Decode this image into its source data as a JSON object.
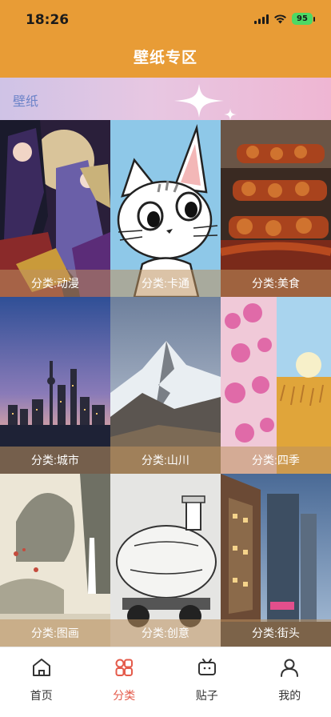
{
  "status_bar": {
    "time": "18:26",
    "battery": "95"
  },
  "header": {
    "title": "壁纸专区"
  },
  "banner": {
    "label": "壁纸"
  },
  "grid": {
    "tiles": [
      {
        "caption": "分类:动漫"
      },
      {
        "caption": "分类:卡通"
      },
      {
        "caption": "分类:美食"
      },
      {
        "caption": "分类:城市"
      },
      {
        "caption": "分类:山川"
      },
      {
        "caption": "分类:四季"
      },
      {
        "caption": "分类:图画"
      },
      {
        "caption": "分类:创意"
      },
      {
        "caption": "分类:街头"
      }
    ]
  },
  "tabbar": {
    "tabs": [
      {
        "label": "首页",
        "icon": "home-icon"
      },
      {
        "label": "分类",
        "icon": "category-icon"
      },
      {
        "label": "贴子",
        "icon": "post-icon"
      },
      {
        "label": "我的",
        "icon": "profile-icon"
      }
    ],
    "active_color": "#e45a4a"
  },
  "colors": {
    "header": "#E89C36",
    "caption_overlay": "rgba(190,145,95,0.55)"
  }
}
